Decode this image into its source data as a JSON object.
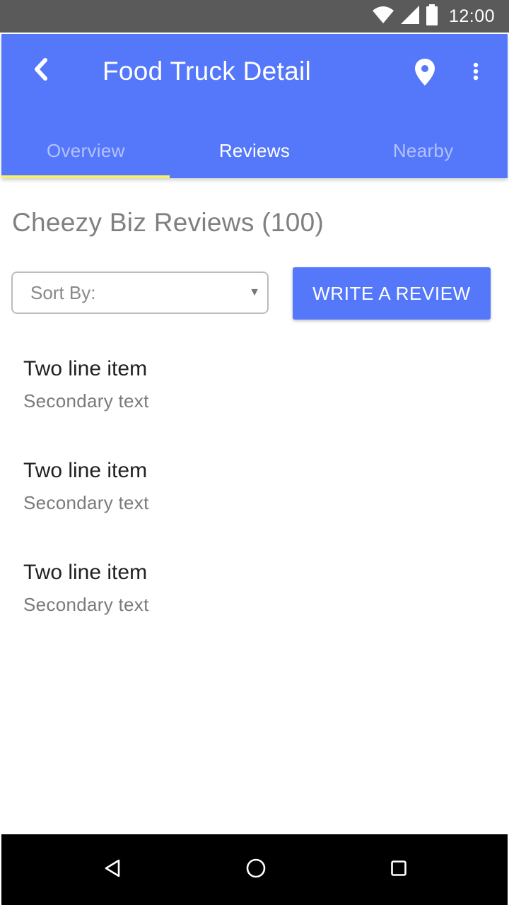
{
  "status_bar": {
    "time": "12:00",
    "icons": [
      "wifi-icon",
      "signal-icon",
      "battery-icon"
    ]
  },
  "app_bar": {
    "title": "Food Truck Detail",
    "back_icon": "chevron-left-icon",
    "location_icon": "map-pin-icon",
    "more_icon": "more-vert-icon",
    "background_color": "#5578fb"
  },
  "tabs": [
    {
      "label": "Overview",
      "selected": true
    },
    {
      "label": "Reviews",
      "selected": false
    },
    {
      "label": "Nearby",
      "selected": false
    }
  ],
  "tab_indicator_color": "#f4f266",
  "page": {
    "heading": "Cheezy Biz Reviews (100)",
    "sort_select": {
      "label": "Sort By:"
    },
    "write_review_label": "WRITE A REVIEW"
  },
  "reviews": [
    {
      "primary": "Two line item",
      "secondary": "Secondary text"
    },
    {
      "primary": "Two line item",
      "secondary": "Secondary text"
    },
    {
      "primary": "Two line item",
      "secondary": "Secondary text"
    }
  ],
  "nav_bar": {
    "icons": [
      "back-triangle-icon",
      "home-circle-icon",
      "recents-square-icon"
    ]
  }
}
